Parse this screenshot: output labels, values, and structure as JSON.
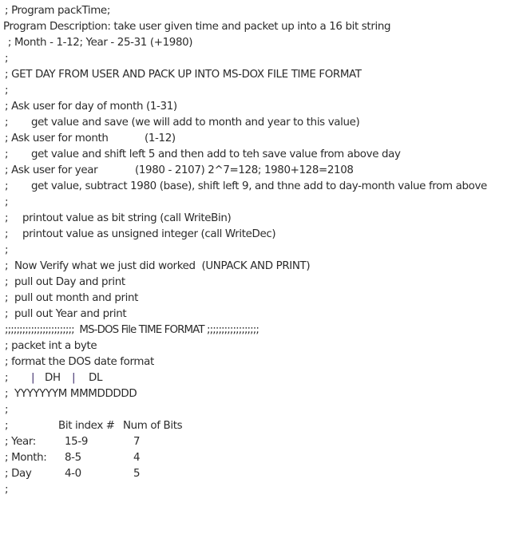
{
  "lines": [
    {
      "text": "; Program packTime;"
    },
    {
      "text": "Program Description: take user given time and packet up into a 16 bit string"
    },
    {
      "text": " ; Month - 1-12; Year - 25-31 (+1980)"
    },
    {
      "text": ";"
    },
    {
      "text": "; GET DAY FROM USER AND PACK UP INTO MS-DOX FILE TIME FORMAT"
    },
    {
      "text": ";"
    },
    {
      "text": "; Ask user for day of month (1-31)"
    },
    {
      "semi": ";",
      "text": "get value and save (we will add to month and year to this value)"
    },
    {
      "text": "; Ask user for month",
      "extra": "(1-12)"
    },
    {
      "semi": ";",
      "text": "get value and shift left 5 and then add to teh save value from above day"
    },
    {
      "text": "; Ask user for year",
      "extra": "(1980 - 2107) 2^7=128; 1980+128=2108"
    },
    {
      "semi": ";",
      "text": "get value, subtract 1980 (base), shift left 9, and thne add to day-month value from above"
    },
    {
      "text": ";"
    },
    {
      "semi": ";",
      "text": "printout value as bit string (call WriteBin)"
    },
    {
      "semi": ";",
      "text": "printout value as unsigned integer (call WriteDec)"
    },
    {
      "text": ";"
    },
    {
      "text": ";  Now Verify what we just did worked  (UNPACK AND PRINT)"
    },
    {
      "text": ";  pull out Day and print"
    },
    {
      "text": ";  pull out month and print"
    },
    {
      "text": ";  pull out Year and print"
    },
    {
      "text": ";;;;;;;;;;;;;;;;;;;;;;;;  MS-DOS File TIME FORMAT ;;;;;;;;;;;;;;;;;;"
    },
    {
      "text": "; packet int a byte"
    },
    {
      "text": "; format the DOS date format"
    },
    {
      "semi": ";",
      "pipe1": "|",
      "dh": "DH",
      "pipe2": "|",
      "dl": "DL"
    },
    {
      "text": ";  YYYYYYYM MMMDDDDD"
    },
    {
      "text": ";"
    }
  ],
  "table": {
    "header_semi": ";",
    "headers": [
      "Bit index #",
      "Num of Bits"
    ],
    "rows": [
      {
        "label": "; Year:",
        "index": "15-9",
        "bits": "7"
      },
      {
        "label": "; Month:",
        "index": "8-5",
        "bits": "4"
      },
      {
        "label": "; Day",
        "index": "4-0",
        "bits": "5"
      }
    ],
    "trailing": ";"
  }
}
